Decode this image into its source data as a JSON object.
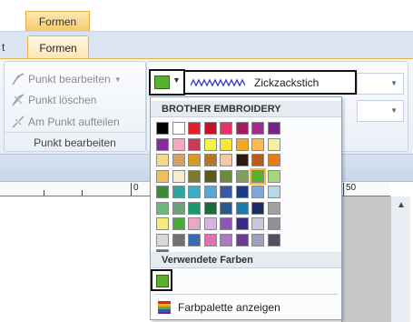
{
  "ribbon": {
    "context_tab": "Formen",
    "active_tab": "Formen",
    "partial_tab": "t",
    "group_punkt": {
      "label": "Punkt bearbeiten",
      "commands": {
        "bearbeiten": "Punkt bearbeiten",
        "loeschen": "Punkt löschen",
        "aufteilen": "Am Punkt aufteilen"
      }
    },
    "stitch": {
      "name": "Zickzackstich",
      "icon": "zigzag-stitch-icon"
    },
    "line_color": "#58b02c"
  },
  "ruler": {
    "labels": [
      "0",
      "50"
    ]
  },
  "palette": {
    "header": "BROTHER EMBROIDERY",
    "used_header": "Verwendete Farben",
    "footer": "Farbpalette anzeigen",
    "used_colors": [
      "#58b02c"
    ],
    "selected_index": 30,
    "colors": [
      "#000000",
      "#ffffff",
      "#e0202a",
      "#c8102e",
      "#e8306a",
      "#a01c5a",
      "#9c2d8a",
      "#7a2386",
      "#8b2aa0",
      "#f2a8c0",
      "#c83a5a",
      "#f3f34a",
      "#f7e83a",
      "#f6a623",
      "#ffb84d",
      "#f4f0a8",
      "#f5d98a",
      "#d3a06a",
      "#d69c2a",
      "#b5762a",
      "#f3c8a0",
      "#2a1a12",
      "#b85a1a",
      "#e87a1a",
      "#f0c060",
      "#f5efd0",
      "#7a7a30",
      "#5c5c1a",
      "#6b8a3a",
      "#80a060",
      "#58b02c",
      "#a4d67a",
      "#3a8a3a",
      "#2aa89a",
      "#3ab0c8",
      "#5aa8d8",
      "#3a5aa8",
      "#1a3a8a",
      "#7fa8d8",
      "#b8d8e8",
      "#6ab87a",
      "#70a07a",
      "#1a9a6a",
      "#1a6a3a",
      "#2a5a8a",
      "#1e7aaa",
      "#1e2a60",
      "#a0a0a0",
      "#f5ec7a",
      "#4aa83a",
      "#e8a8c8",
      "#d8b0e0",
      "#8a5ab0",
      "#3a2a8a",
      "#c8c8d8",
      "#909098",
      "#d8d8d8",
      "#707070",
      "#3a6ab0",
      "#e070b0",
      "#b07ac0",
      "#6a3a9a",
      "#a0a0c0",
      "#505060",
      "#707078"
    ]
  }
}
